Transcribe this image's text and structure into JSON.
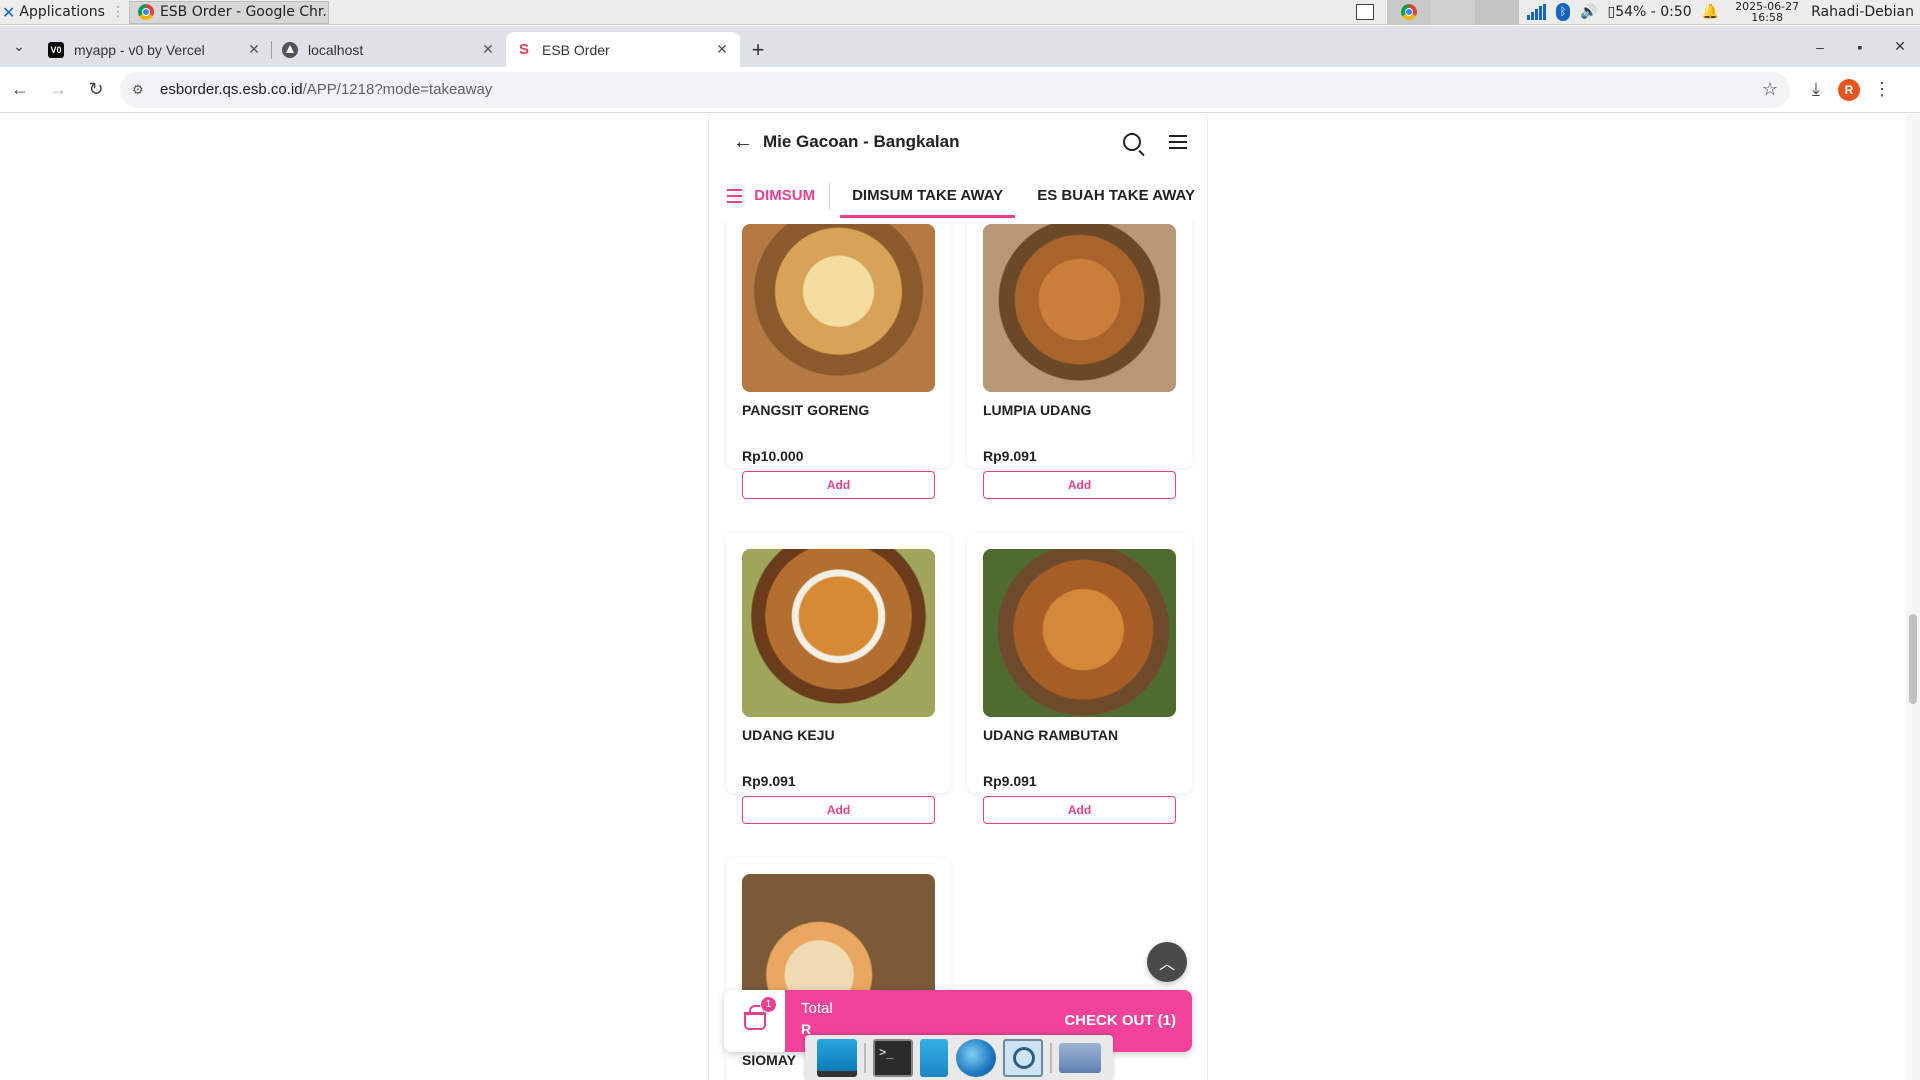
{
  "os": {
    "applications_label": "Applications",
    "active_task": "ESB Order - Google Chr...",
    "battery": "54% - 0:50",
    "date": "2025-06-27",
    "time": "16:58",
    "user": "Rahadi-Debian"
  },
  "browser": {
    "tabs": [
      {
        "title": "myapp - v0 by Vercel",
        "icon": "v0-icon"
      },
      {
        "title": "localhost",
        "icon": "localhost-icon"
      },
      {
        "title": "ESB Order",
        "icon": "esb-icon",
        "active": true
      }
    ],
    "url_host": "esborder.qs.esb.co.id",
    "url_path": "/APP/1218?mode=takeaway",
    "profile_initial": "R"
  },
  "app": {
    "store_name": "Mie Gacoan - Bangkalan",
    "category_menu_label": "DIMSUM",
    "category_tabs": [
      "DIMSUM TAKE AWAY",
      "ES BUAH TAKE AWAY"
    ],
    "active_tab": "DIMSUM TAKE AWAY",
    "accent_color": "#e8408f",
    "products": [
      {
        "name": "PANGSIT GORENG",
        "price": "Rp10.000",
        "add_label": "Add"
      },
      {
        "name": "LUMPIA UDANG",
        "price": "Rp9.091",
        "add_label": "Add"
      },
      {
        "name": "UDANG KEJU",
        "price": "Rp9.091",
        "add_label": "Add"
      },
      {
        "name": "UDANG RAMBUTAN",
        "price": "Rp9.091",
        "add_label": "Add"
      },
      {
        "name": "SIOMAY",
        "price": "",
        "add_label": ""
      }
    ],
    "cart": {
      "badge_count": "1",
      "total_label": "Total",
      "total_amount_partial": "R",
      "checkout_label": "CHECK OUT (1)"
    }
  }
}
